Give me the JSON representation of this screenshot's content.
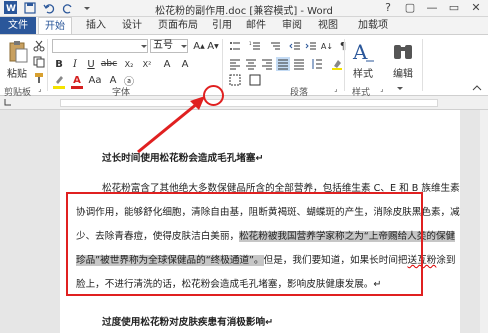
{
  "window": {
    "title": "松花粉的副作用.doc [兼容模式] - Word",
    "controls": [
      "?",
      "▢",
      "—",
      "▭",
      "✕"
    ]
  },
  "tabs": [
    {
      "label": "文件"
    },
    {
      "label": "开始"
    },
    {
      "label": "插入"
    },
    {
      "label": "设计"
    },
    {
      "label": "页面布局"
    },
    {
      "label": "引用"
    },
    {
      "label": "邮件"
    },
    {
      "label": "审阅"
    },
    {
      "label": "视图"
    },
    {
      "label": "加载项"
    }
  ],
  "ribbon": {
    "clipboard": {
      "label": "剪贴板",
      "paste_label": "粘贴"
    },
    "font": {
      "label": "字体",
      "font_name": "",
      "font_size": "五号",
      "font_color": "#d42020",
      "highlight_color": "#f4e300"
    },
    "paragraph": {
      "label": "段落"
    },
    "styles": {
      "label": "样式",
      "button_label": "样式"
    },
    "editing": {
      "label": "编辑",
      "button_label": "编辑"
    }
  },
  "document": {
    "heading1": "过长时间使用松花粉会造成毛孔堵塞↵",
    "para1_line1": "松花粉富含了其他绝大多数保健品所含的全部营养，包括维生素 C、E 和 B 族维生素",
    "para1_line2": "协调作用，能够舒化细胞，清除自由基，阻断黄褐斑、蝴蝶斑的产生，消除皮肤黑色素，减",
    "para1_line3_a": "少、去除青春痘，使得皮肤洁白美丽，",
    "para1_line3_b": "松花粉被我国营养学家称之为“上帝赐给人类的保健",
    "para1_line4_a": "珍品”被世界称为全球保健品的“终极通道”。",
    "para1_line4_b": "但是，我们要知道，如果长时间把",
    "para1_line4_c": "送互粉",
    "para1_line4_d": "涂到",
    "para1_line5": "脸上，不进行清洗的话，松花粉会造成毛孔堵塞，影响皮肤健康发展。↵",
    "heading2": "过度使用松花粉对皮肤疾患有消极影响↵"
  }
}
